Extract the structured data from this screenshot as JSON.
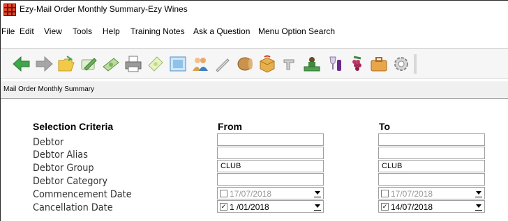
{
  "window": {
    "title": "Ezy-Mail Order Monthly Summary-Ezy Wines"
  },
  "menu": {
    "items": [
      "File",
      "Edit",
      "View",
      "Tools",
      "Help",
      "Training Notes",
      "Ask a Question",
      "Menu Option Search"
    ]
  },
  "toolbar": {
    "icons": [
      "back-arrow-icon",
      "forward-arrow-icon",
      "open-folder-icon",
      "pen-icon",
      "money-icon",
      "printer-icon",
      "cash-icon",
      "calendar-icon",
      "people-icon",
      "pencil-icon",
      "barrel-icon",
      "box-icon",
      "faucet-icon",
      "desk-icon",
      "wine-glass-icon",
      "grapes-icon",
      "briefcase-icon",
      "gear-icon"
    ]
  },
  "panel": {
    "heading": "Mail Order Monthly Summary"
  },
  "form": {
    "section_title": "Selection Criteria",
    "from_header": "From",
    "to_header": "To",
    "labels": {
      "debtor": "Debtor",
      "debtor_alias": "Debtor Alias",
      "debtor_group": "Debtor Group",
      "debtor_category": "Debtor Category",
      "commencement_date": "Commencement Date",
      "cancellation_date": "Cancellation Date"
    },
    "from": {
      "debtor": "",
      "debtor_alias": "",
      "debtor_group": "CLUB",
      "debtor_category": "",
      "commencement_date": "17/07/2018",
      "commencement_checked": false,
      "cancellation_date": "1 /01/2018",
      "cancellation_checked": true
    },
    "to": {
      "debtor": "",
      "debtor_alias": "",
      "debtor_group": "CLUB",
      "debtor_category": "",
      "commencement_date": "17/07/2018",
      "commencement_checked": false,
      "cancellation_date": "14/07/2018",
      "cancellation_checked": true
    }
  }
}
